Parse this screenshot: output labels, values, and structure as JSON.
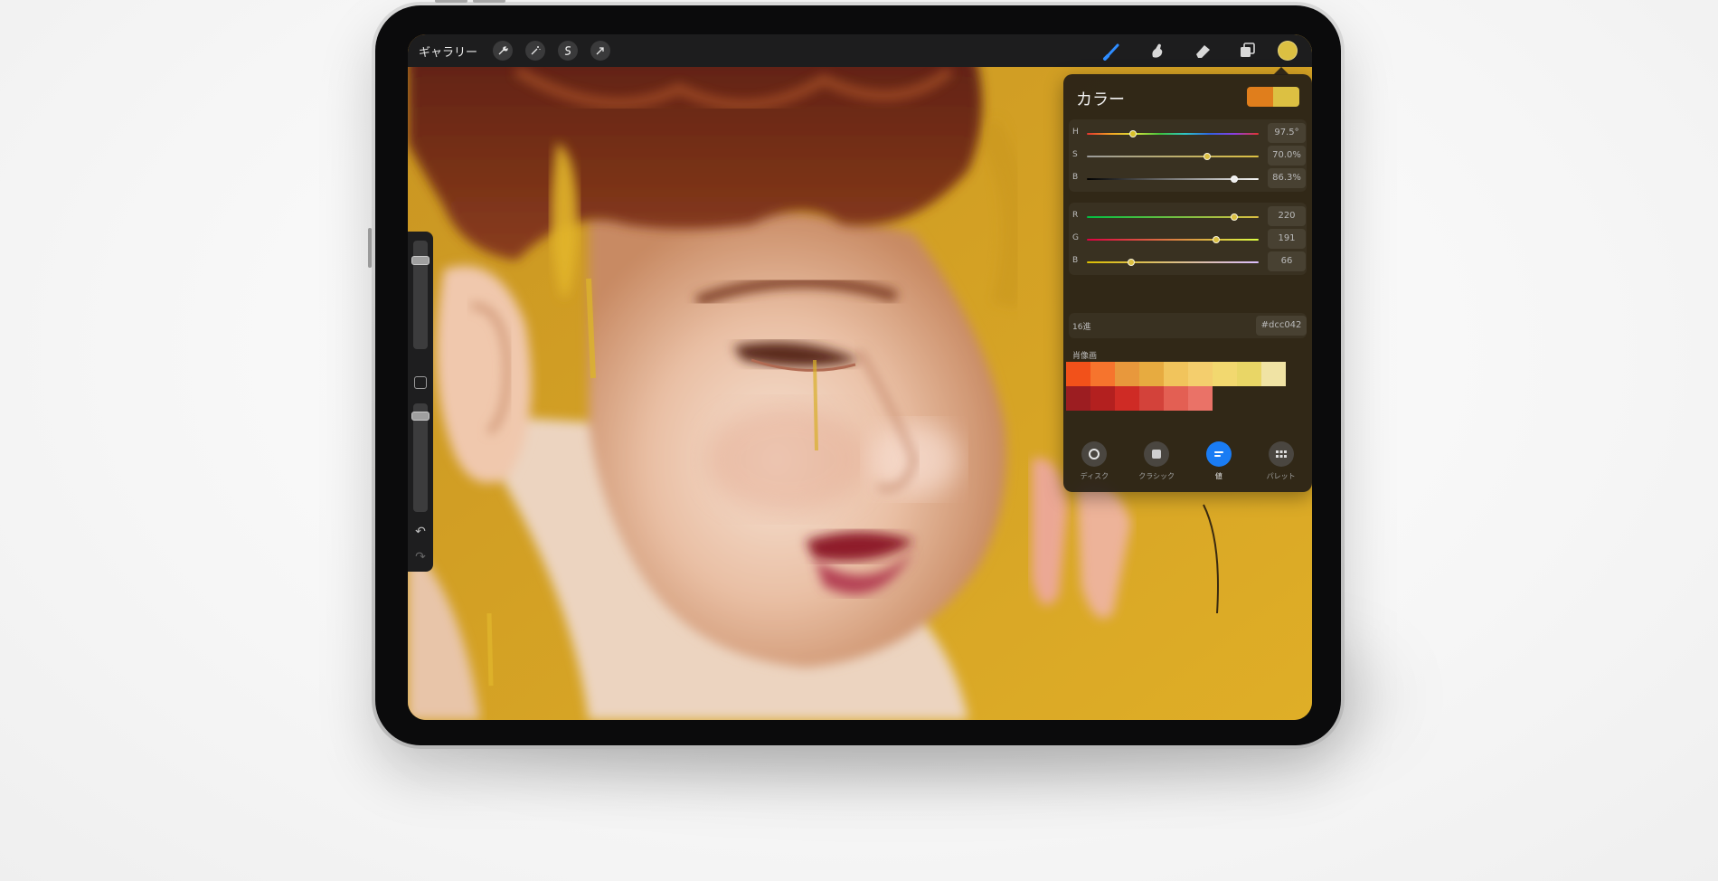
{
  "toolbar": {
    "gallery_label": "ギャラリー",
    "left_tools": [
      "wrench-icon",
      "magic-wand-icon",
      "selection-icon",
      "transform-arrow-icon"
    ],
    "right_tools": [
      "brush-icon",
      "smudge-icon",
      "eraser-icon",
      "layers-icon"
    ],
    "current_color": "#dcc042"
  },
  "sidebar": {
    "brush_size_level": 0.15,
    "opacity_level": 0.08
  },
  "color_panel": {
    "title": "カラー",
    "primary_swatch": "#e07e1c",
    "secondary_swatch": "#dcc042",
    "hsb": [
      {
        "label": "H",
        "value": "97.5°",
        "position": 0.27,
        "knob": "#d8c02a"
      },
      {
        "label": "S",
        "value": "70.0%",
        "position": 0.7,
        "knob": "#dcc042"
      },
      {
        "label": "B",
        "value": "86.3%",
        "position": 0.86,
        "knob": "#eeeeee"
      }
    ],
    "rgb": [
      {
        "label": "R",
        "value": "220",
        "position": 0.86,
        "knob": "#dcc042"
      },
      {
        "label": "G",
        "value": "191",
        "position": 0.75,
        "knob": "#dcc042"
      },
      {
        "label": "B",
        "value": "66",
        "position": 0.26,
        "knob": "#dcc042"
      }
    ],
    "hex_label": "16進",
    "hex_value": "#dcc042",
    "palette_name": "肖像画",
    "palette_row1": [
      "#f2511a",
      "#f6742d",
      "#e8983c",
      "#e7ab40",
      "#f1c45c",
      "#f4ce6d",
      "#f2d86f",
      "#e9d666",
      "#f0e3a4"
    ],
    "palette_row2": [
      "#9c1d21",
      "#b3201f",
      "#cf2b25",
      "#d3423a",
      "#e35f53",
      "#ea7267"
    ],
    "modes": [
      {
        "label": "ディスク",
        "icon": "disc-icon",
        "active": false
      },
      {
        "label": "クラシック",
        "icon": "classic-icon",
        "active": false
      },
      {
        "label": "値",
        "icon": "value-icon",
        "active": true
      },
      {
        "label": "パレット",
        "icon": "palette-icon",
        "active": false
      }
    ]
  }
}
